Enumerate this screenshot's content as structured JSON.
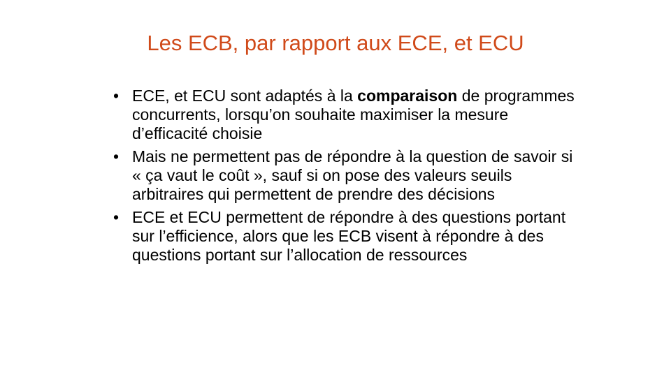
{
  "slide": {
    "title": "Les ECB, par rapport aux ECE, et ECU",
    "bullets": [
      {
        "text_before": "ECE, et ECU sont adaptés à la ",
        "text_bold": "comparaison",
        "text_after": " de programmes concurrents, lorsqu’on souhaite maximiser la mesure d’efficacité choisie"
      },
      {
        "text": "Mais ne permettent pas de répondre à la question de savoir si « ça vaut le coût », sauf si on pose des valeurs seuils arbitraires qui permettent de prendre des décisions"
      },
      {
        "text": "ECE et ECU permettent de répondre à des questions portant sur l’efficience, alors que les ECB visent à répondre à des  questions portant sur l’allocation de ressources"
      }
    ],
    "bullet_symbol": "•",
    "colors": {
      "title": "#d04a1a",
      "text": "#000000",
      "background": "#ffffff"
    }
  }
}
